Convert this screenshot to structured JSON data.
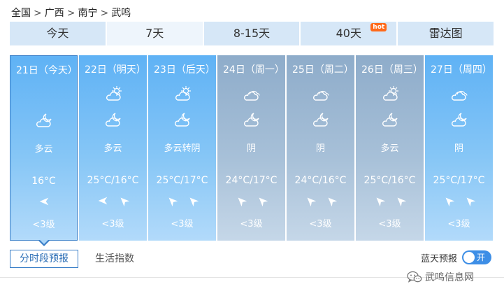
{
  "breadcrumb": [
    {
      "label": "全国"
    },
    {
      "label": "广西"
    },
    {
      "label": "南宁"
    },
    {
      "label": "武鸣"
    }
  ],
  "breadcrumb_separator": ">",
  "tabs": [
    {
      "label": "今天",
      "active": false
    },
    {
      "label": "7天",
      "active": true
    },
    {
      "label": "8-15天",
      "active": false
    },
    {
      "label": "40天",
      "active": false,
      "badge": "hot"
    },
    {
      "label": "雷达图",
      "active": false
    }
  ],
  "days": [
    {
      "date": "21日（今天）",
      "day_icon": null,
      "night_icon": "partly-cloudy-night-icon",
      "condition": "多云",
      "temp": "16°C",
      "winds": [
        "west"
      ],
      "wind_level": "<3级",
      "style": "today"
    },
    {
      "date": "22日（明天）",
      "day_icon": "partly-cloudy-day-icon",
      "night_icon": "partly-cloudy-night-icon",
      "condition": "多云",
      "temp": "25°C/16°C",
      "winds": [
        "west",
        "northwest"
      ],
      "wind_level": "<3级",
      "style": "blue"
    },
    {
      "date": "23日（后天）",
      "day_icon": "partly-cloudy-day-icon",
      "night_icon": "partly-cloudy-night-icon",
      "condition": "多云转阴",
      "temp": "25°C/17°C",
      "winds": [
        "northwest",
        "northwest"
      ],
      "wind_level": "<3级",
      "style": "blue"
    },
    {
      "date": "24日（周一）",
      "day_icon": "overcast-icon",
      "night_icon": "partly-cloudy-night-icon",
      "condition": "阴",
      "temp": "24°C/17°C",
      "winds": [
        "northwest",
        "northwest"
      ],
      "wind_level": "<3级",
      "style": "gray"
    },
    {
      "date": "25日（周二）",
      "day_icon": "overcast-icon",
      "night_icon": "partly-cloudy-night-icon",
      "condition": "阴",
      "temp": "24°C/16°C",
      "winds": [
        "northwest",
        "northwest"
      ],
      "wind_level": "<3级",
      "style": "gray"
    },
    {
      "date": "26日（周三）",
      "day_icon": "partly-cloudy-day-icon",
      "night_icon": "partly-cloudy-night-icon",
      "condition": "多云",
      "temp": "25°C/16°C",
      "winds": [
        "northwest",
        "northwest"
      ],
      "wind_level": "<3级",
      "style": "gray"
    },
    {
      "date": "27日（周四）",
      "day_icon": "overcast-icon",
      "night_icon": "partly-cloudy-night-icon",
      "condition": "阴",
      "temp": "25°C/17°C",
      "winds": [
        "northwest",
        "northwest"
      ],
      "wind_level": "<3级",
      "style": "blue"
    }
  ],
  "bottom": {
    "hourly_label": "分时段预报",
    "life_label": "生活指数",
    "blue_sky_label": "蓝天预报",
    "toggle_label": "开",
    "toggle_on": true
  },
  "watermark": {
    "text": "武鸣信息网",
    "icon": "wechat-icon"
  },
  "colors": {
    "accent": "#3a7fc8",
    "day_blue": "#5fb2f5",
    "day_gray": "#8eacca",
    "tab_bg": "#d6e7f7",
    "hot_badge": "#ff6a1a",
    "toggle": "#3d8ee6"
  }
}
